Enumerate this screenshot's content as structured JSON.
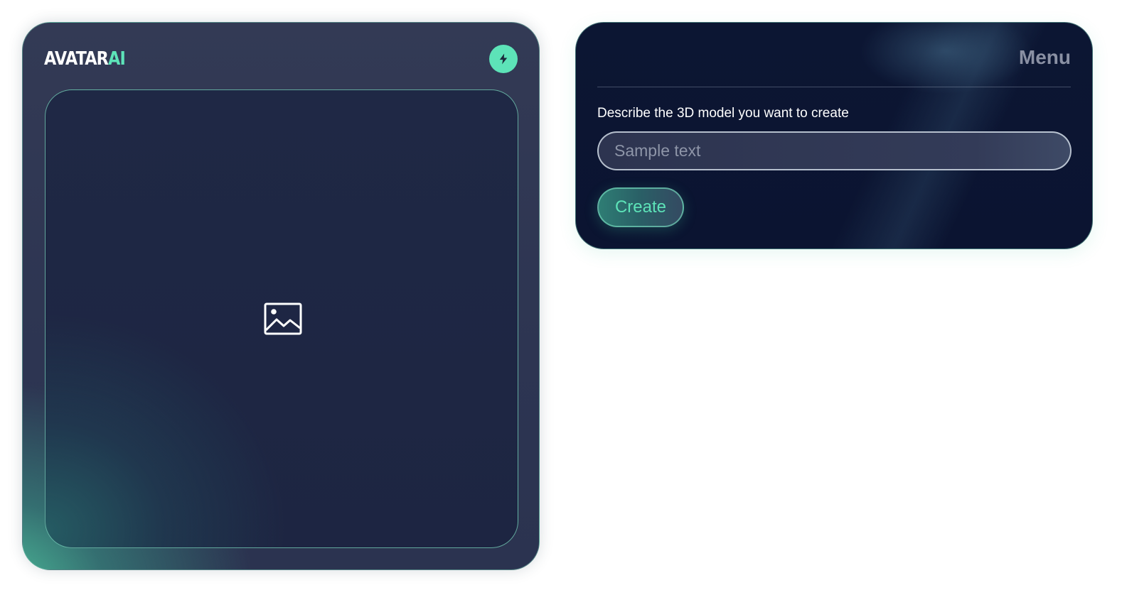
{
  "left_panel": {
    "logo": {
      "main": "AVATAR",
      "accent": "AI"
    },
    "badge_icon": "lightning-bolt-icon",
    "preview_icon": "image-placeholder-icon"
  },
  "right_panel": {
    "menu_label": "Menu",
    "prompt_label": "Describe the 3D model you want to create",
    "prompt_input": {
      "placeholder": "Sample text",
      "value": ""
    },
    "create_label": "Create"
  },
  "colors": {
    "accent": "#5de3b8",
    "card_dark": "#0c1633",
    "card_slate": "#2d3552"
  }
}
